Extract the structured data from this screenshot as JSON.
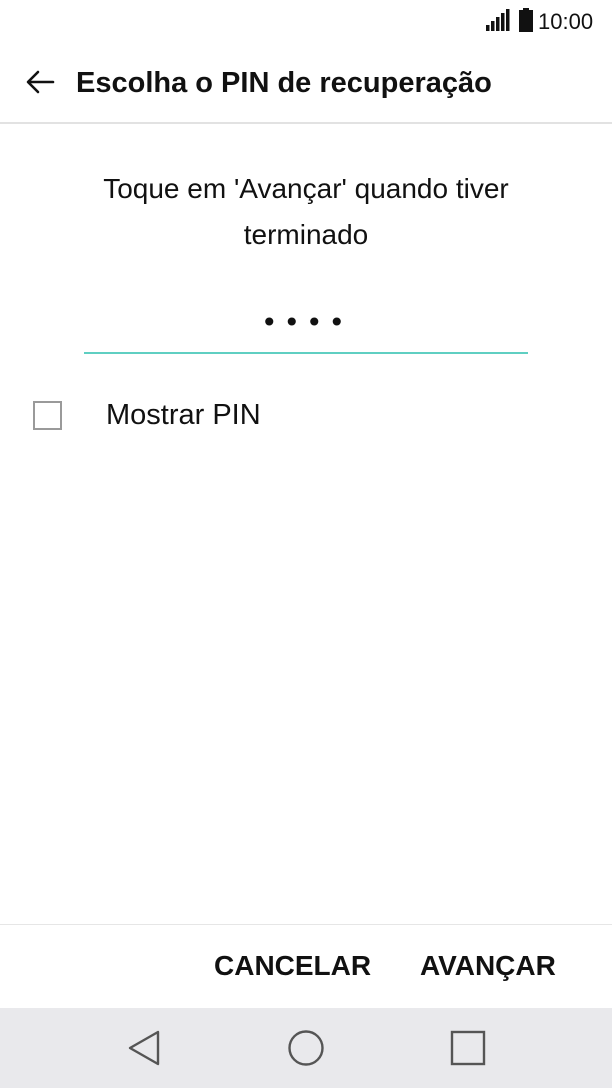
{
  "status_bar": {
    "time": "10:00",
    "icons": [
      "signal-icon",
      "battery-icon"
    ]
  },
  "app_bar": {
    "title": "Escolha o PIN de recuperação",
    "back_icon": "arrow-left-icon"
  },
  "instruction": "Toque em 'Avançar' quando tiver terminado",
  "pin_field": {
    "value": "••••"
  },
  "show_pin": {
    "label": "Mostrar PIN",
    "checked": false
  },
  "buttons": {
    "cancel": "CANCELAR",
    "next": "AVANÇAR"
  },
  "nav_bar": {
    "icons": [
      "triangle-back-icon",
      "circle-home-icon",
      "square-recent-icon"
    ]
  },
  "colors": {
    "accent_underline": "#5fcfc2",
    "nav_background": "#e9e9ec"
  }
}
